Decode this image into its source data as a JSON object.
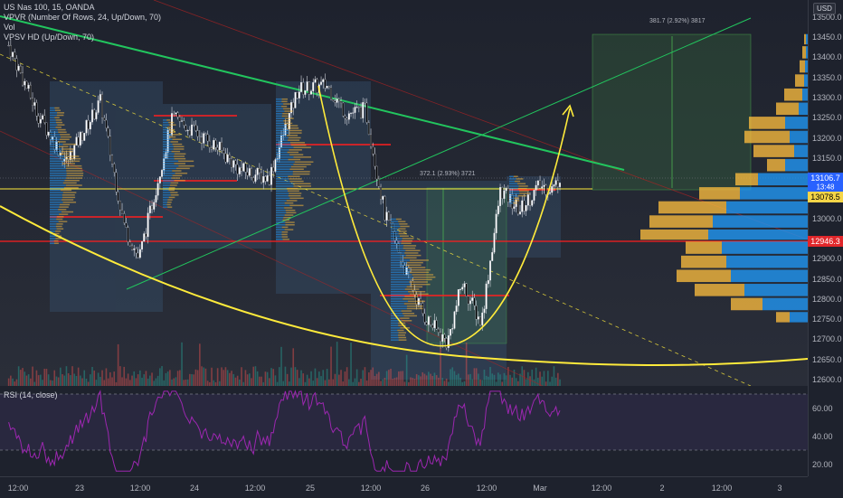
{
  "legend": {
    "symbol": "US Nas 100, 15, OANDA",
    "vpvr": "VPVR (Number Of Rows, 24, Up/Down, 70)",
    "vol": "Vol",
    "vpsv": "VPSV HD (Up/Down, 70)"
  },
  "rsi_legend": "RSI (14, close)",
  "currency": "USD",
  "price_ticks": [
    "13500.0",
    "13450.0",
    "13400.0",
    "13350.0",
    "13300.0",
    "13250.0",
    "13200.0",
    "13150.0",
    "13000.0",
    "12900.0",
    "12850.0",
    "12800.0",
    "12750.0",
    "12700.0",
    "12650.0",
    "12600.0"
  ],
  "rsi_ticks": [
    "60.00",
    "40.00",
    "20.00"
  ],
  "time_ticks": [
    "12:00",
    "23",
    "12:00",
    "24",
    "12:00",
    "25",
    "12:00",
    "26",
    "12:00",
    "Mar",
    "12:00",
    "2",
    "12:00",
    "3"
  ],
  "price_tags": {
    "current": "13106.7",
    "countdown": "13:48",
    "level1": "13078.5",
    "level2": "12946.3"
  },
  "annotations": {
    "measure_top": "381.7 (2.92%) 3817",
    "measure_mid": "372.1 (2.93%) 3721"
  },
  "colors": {
    "background": "#1e222d",
    "up_candle": "#ffffff",
    "down_candle": "#000000",
    "trend_green": "#22c55e",
    "curve_yellow": "#ffeb3b",
    "level_red": "#ff1e1e",
    "rsi_purple": "#9c27b0",
    "vp_up": "#2196f3",
    "vp_down": "#f5b83d",
    "price_tag_blue": "#2962ff",
    "price_tag_red": "#e0272b",
    "price_tag_yellow": "#f5d547"
  },
  "chart_data": {
    "type": "candlestick",
    "symbol": "US Nas 100",
    "interval": "15",
    "ylim": [
      12600,
      13520
    ],
    "current_price": 13106.7,
    "horizontal_levels": [
      13078.5,
      12946.3
    ],
    "path_keypoints": [
      {
        "x": "Feb 22 08:00",
        "y": 13430
      },
      {
        "x": "Feb 22 14:00",
        "y": 13260
      },
      {
        "x": "Feb 22 20:00",
        "y": 13140
      },
      {
        "x": "Feb 23 03:00",
        "y": 13290
      },
      {
        "x": "Feb 23 08:00",
        "y": 12980
      },
      {
        "x": "Feb 23 11:00",
        "y": 12900
      },
      {
        "x": "Feb 23 14:00",
        "y": 13050
      },
      {
        "x": "Feb 23 18:00",
        "y": 13250
      },
      {
        "x": "Feb 24 03:00",
        "y": 13180
      },
      {
        "x": "Feb 24 08:00",
        "y": 13120
      },
      {
        "x": "Feb 24 14:00",
        "y": 13100
      },
      {
        "x": "Feb 24 20:00",
        "y": 13320
      },
      {
        "x": "Feb 25 02:00",
        "y": 13330
      },
      {
        "x": "Feb 25 06:00",
        "y": 13260
      },
      {
        "x": "Feb 25 10:00",
        "y": 13270
      },
      {
        "x": "Feb 25 14:00",
        "y": 13010
      },
      {
        "x": "Feb 25 18:00",
        "y": 12880
      },
      {
        "x": "Feb 25 22:00",
        "y": 12760
      },
      {
        "x": "Feb 26 03:00",
        "y": 12690
      },
      {
        "x": "Feb 26 06:00",
        "y": 12840
      },
      {
        "x": "Feb 26 10:00",
        "y": 12740
      },
      {
        "x": "Feb 26 14:00",
        "y": 13070
      },
      {
        "x": "Feb 26 18:00",
        "y": 13020
      },
      {
        "x": "Feb 26 22:00",
        "y": 13080
      },
      {
        "x": "Mar 01 01:00",
        "y": 13075
      },
      {
        "x": "Mar 01 02:30",
        "y": 13106.7
      }
    ],
    "rsi": {
      "period": 14,
      "levels": [
        70,
        30
      ],
      "ylim": [
        10,
        75
      ]
    }
  }
}
